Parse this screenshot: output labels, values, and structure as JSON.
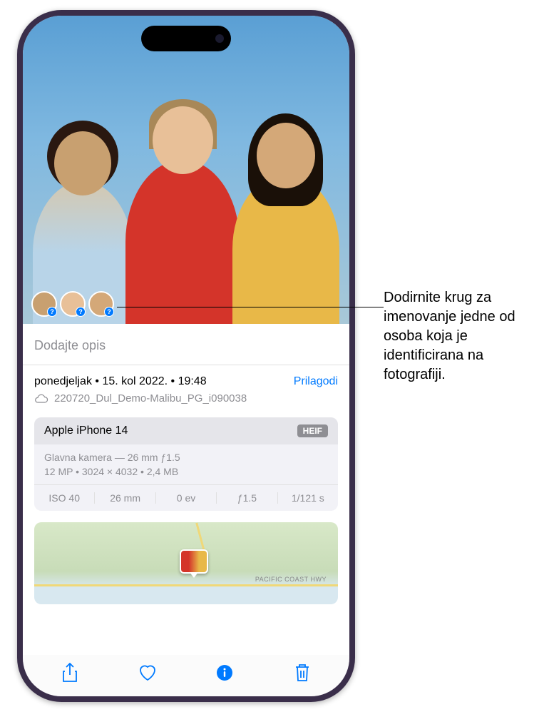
{
  "photo": {
    "face_badges": [
      "?",
      "?",
      "?"
    ]
  },
  "info": {
    "caption_placeholder": "Dodajte opis",
    "date_text": "ponedjeljak • 15. kol 2022. • 19:48",
    "adjust_label": "Prilagodi",
    "filename": "220720_Dul_Demo-Malibu_PG_i090038",
    "metadata": {
      "device": "Apple iPhone 14",
      "format": "HEIF",
      "lens": "Glavna kamera — 26 mm ƒ1.5",
      "specs": "12 MP  •  3024 × 4032  •  2,4 MB",
      "cells": [
        "ISO 40",
        "26 mm",
        "0 ev",
        "ƒ1.5",
        "1/121 s"
      ]
    },
    "map_label": "PACIFIC COAST HWY"
  },
  "callout": {
    "text": "Dodirnite krug za imenovanje jedne od osoba koja je identificirana na fotografiji."
  }
}
